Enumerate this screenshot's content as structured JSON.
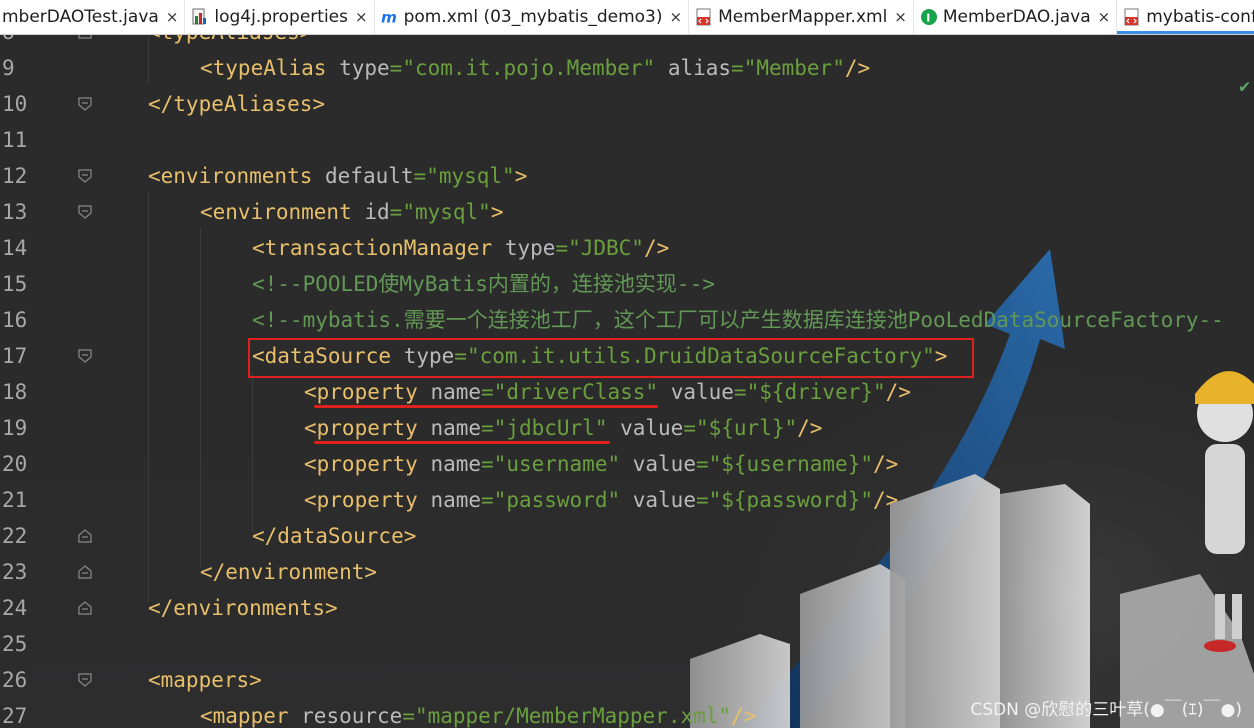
{
  "tabs": [
    {
      "label": "mberDAOTest.java",
      "icon": "java-class-icon",
      "active": false
    },
    {
      "label": "log4j.properties",
      "icon": "properties-file-icon",
      "active": false
    },
    {
      "label": "pom.xml (03_mybatis_demo3)",
      "icon": "maven-icon",
      "active": false
    },
    {
      "label": "MemberMapper.xml",
      "icon": "xml-file-icon",
      "active": false
    },
    {
      "label": "MemberDAO.java",
      "icon": "java-interface-icon",
      "active": false
    },
    {
      "label": "mybatis-config.xml",
      "icon": "xml-file-icon",
      "active": true
    }
  ],
  "close_glyph": "×",
  "lines": [
    {
      "num": "8",
      "text": "<typeAliases>"
    },
    {
      "num": "9",
      "text": "<typeAlias type=\"com.it.pojo.Member\" alias=\"Member\"/>"
    },
    {
      "num": "10",
      "text": "</typeAliases>"
    },
    {
      "num": "11",
      "text": ""
    },
    {
      "num": "12",
      "text": "<environments default=\"mysql\">"
    },
    {
      "num": "13",
      "text": "<environment id=\"mysql\">"
    },
    {
      "num": "14",
      "text": "<transactionManager type=\"JDBC\"/>"
    },
    {
      "num": "15",
      "text": "<!--POOLED使MyBatis内置的，连接池实现-->"
    },
    {
      "num": "16",
      "text": "<!--mybatis.需要一个连接池工厂，这个工厂可以产生数据库连接池PooLedDataSourceFactory--"
    },
    {
      "num": "17",
      "text": "<dataSource type=\"com.it.utils.DruidDataSourceFactory\">"
    },
    {
      "num": "18",
      "text": "<property name=\"driverClass\" value=\"${driver}\"/>"
    },
    {
      "num": "19",
      "text": "<property name=\"jdbcUrl\" value=\"${url}\"/>"
    },
    {
      "num": "20",
      "text": "<property name=\"username\" value=\"${username}\"/>"
    },
    {
      "num": "21",
      "text": "<property name=\"password\" value=\"${password}\"/>"
    },
    {
      "num": "22",
      "text": "</dataSource>"
    },
    {
      "num": "23",
      "text": "</environment>"
    },
    {
      "num": "24",
      "text": "</environments>"
    },
    {
      "num": "25",
      "text": ""
    },
    {
      "num": "26",
      "text": "<mappers>"
    },
    {
      "num": "27",
      "text": "<mapper resource=\"mapper/MemberMapper.xml\"/>"
    }
  ],
  "watermark": "CSDN @欣慰的三叶草(●￣(ｴ)￣●)",
  "colors": {
    "tag": "#e8bf6a",
    "attr": "#bababa",
    "value": "#6a9f3e",
    "comment": "#629755",
    "highlight": "#e0201c"
  }
}
